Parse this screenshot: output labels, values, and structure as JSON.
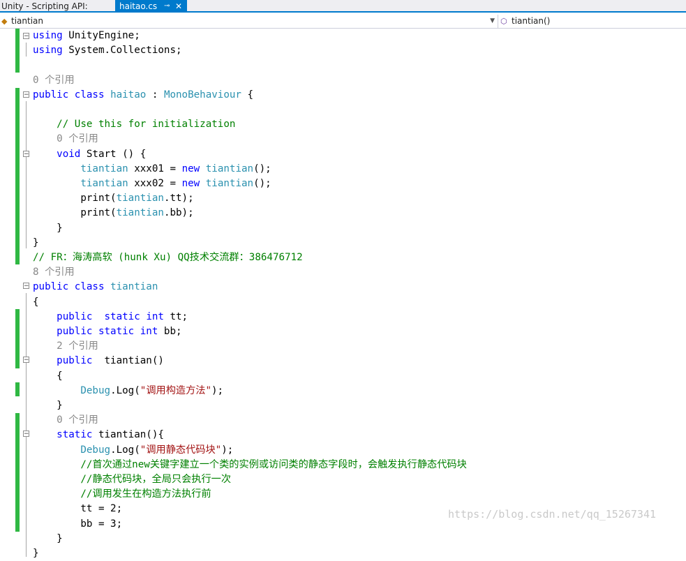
{
  "tabs": [
    {
      "label": "Unity - Scripting API:"
    },
    {
      "label": "haitao.cs",
      "pin": "⊸",
      "close": "✕"
    }
  ],
  "nav": {
    "left": "tiantian",
    "right": "tiantian()"
  },
  "code": [
    [
      [
        "k",
        "using"
      ],
      [
        "p",
        " UnityEngine;"
      ]
    ],
    [
      [
        "k",
        "using"
      ],
      [
        "p",
        " System.Collections;"
      ]
    ],
    [],
    [
      [
        "r",
        "0 个引用"
      ]
    ],
    [
      [
        "k",
        "public"
      ],
      [
        "p",
        " "
      ],
      [
        "k",
        "class"
      ],
      [
        "p",
        " "
      ],
      [
        "t",
        "haitao"
      ],
      [
        "p",
        " : "
      ],
      [
        "t",
        "MonoBehaviour"
      ],
      [
        "p",
        " {"
      ]
    ],
    [],
    [
      [
        "p",
        "    "
      ],
      [
        "c",
        "// Use this for initialization"
      ]
    ],
    [
      [
        "p",
        "    "
      ],
      [
        "r",
        "0 个引用"
      ]
    ],
    [
      [
        "p",
        "    "
      ],
      [
        "k",
        "void"
      ],
      [
        "p",
        " Start () {"
      ]
    ],
    [
      [
        "p",
        "        "
      ],
      [
        "t",
        "tiantian"
      ],
      [
        "p",
        " xxx01 = "
      ],
      [
        "k",
        "new"
      ],
      [
        "p",
        " "
      ],
      [
        "t",
        "tiantian"
      ],
      [
        "p",
        "();"
      ]
    ],
    [
      [
        "p",
        "        "
      ],
      [
        "t",
        "tiantian"
      ],
      [
        "p",
        " xxx02 = "
      ],
      [
        "k",
        "new"
      ],
      [
        "p",
        " "
      ],
      [
        "t",
        "tiantian"
      ],
      [
        "p",
        "();"
      ]
    ],
    [
      [
        "p",
        "        print("
      ],
      [
        "t",
        "tiantian"
      ],
      [
        "p",
        ".tt);"
      ]
    ],
    [
      [
        "p",
        "        print("
      ],
      [
        "t",
        "tiantian"
      ],
      [
        "p",
        ".bb);"
      ]
    ],
    [
      [
        "p",
        "    }"
      ]
    ],
    [
      [
        "p",
        "}"
      ]
    ],
    [
      [
        "c",
        "// FR：海涛高软 (hunk Xu) QQ技术交流群：386476712"
      ]
    ],
    [
      [
        "r",
        "8 个引用"
      ]
    ],
    [
      [
        "k",
        "public"
      ],
      [
        "p",
        " "
      ],
      [
        "k",
        "class"
      ],
      [
        "p",
        " "
      ],
      [
        "t",
        "tiantian"
      ]
    ],
    [
      [
        "p",
        "{"
      ]
    ],
    [
      [
        "p",
        "    "
      ],
      [
        "k",
        "public"
      ],
      [
        "p",
        "  "
      ],
      [
        "k",
        "static"
      ],
      [
        "p",
        " "
      ],
      [
        "k",
        "int"
      ],
      [
        "p",
        " tt;"
      ]
    ],
    [
      [
        "p",
        "    "
      ],
      [
        "k",
        "public"
      ],
      [
        "p",
        " "
      ],
      [
        "k",
        "static"
      ],
      [
        "p",
        " "
      ],
      [
        "k",
        "int"
      ],
      [
        "p",
        " bb;"
      ]
    ],
    [
      [
        "p",
        "    "
      ],
      [
        "r",
        "2 个引用"
      ]
    ],
    [
      [
        "p",
        "    "
      ],
      [
        "k",
        "public"
      ],
      [
        "p",
        "  tiantian()"
      ]
    ],
    [
      [
        "p",
        "    {"
      ]
    ],
    [
      [
        "p",
        "        "
      ],
      [
        "t",
        "Debug"
      ],
      [
        "p",
        ".Log("
      ],
      [
        "s",
        "\"调用构造方法\""
      ],
      [
        "p",
        ");"
      ]
    ],
    [
      [
        "p",
        "    }"
      ]
    ],
    [
      [
        "p",
        "    "
      ],
      [
        "r",
        "0 个引用"
      ]
    ],
    [
      [
        "p",
        "    "
      ],
      [
        "k",
        "static"
      ],
      [
        "p",
        " tiantian(){"
      ]
    ],
    [
      [
        "p",
        "        "
      ],
      [
        "t",
        "Debug"
      ],
      [
        "p",
        ".Log("
      ],
      [
        "s",
        "\"调用静态代码块\""
      ],
      [
        "p",
        ");"
      ]
    ],
    [
      [
        "p",
        "        "
      ],
      [
        "c",
        "//首次通过new关键字建立一个类的实例或访问类的静态字段时，会触发执行静态代码块"
      ]
    ],
    [
      [
        "p",
        "        "
      ],
      [
        "c",
        "//静态代码块，全局只会执行一次"
      ]
    ],
    [
      [
        "p",
        "        "
      ],
      [
        "c",
        "//调用发生在构造方法执行前"
      ]
    ],
    [
      [
        "p",
        "        tt = 2;"
      ]
    ],
    [
      [
        "p",
        "        bb = 3;"
      ]
    ],
    [
      [
        "p",
        "    }"
      ]
    ],
    [
      [
        "p",
        "}"
      ]
    ]
  ],
  "watermark": "https://blog.csdn.net/qq_15267341",
  "colors": {
    "keyword": "#0000ff",
    "type": "#2b91af",
    "comment": "#008000",
    "string": "#a31515",
    "codelens": "#888888",
    "change_bar": "#2fb843",
    "tab_active": "#007acc"
  }
}
